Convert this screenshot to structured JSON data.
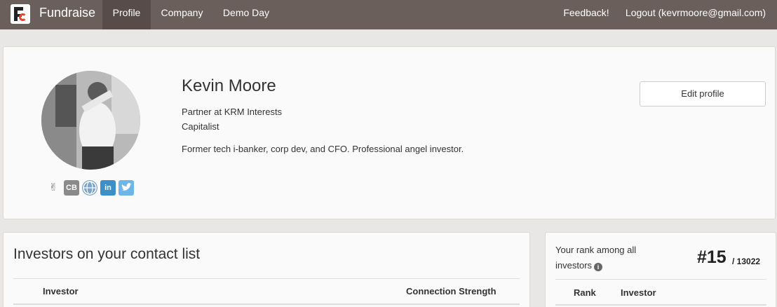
{
  "nav": {
    "brand": "Fundraise",
    "items": [
      {
        "label": "Profile",
        "active": true
      },
      {
        "label": "Company",
        "active": false
      },
      {
        "label": "Demo Day",
        "active": false
      }
    ],
    "feedback": "Feedback!",
    "logout": "Logout (kevrmoore@gmail.com)"
  },
  "profile": {
    "name": "Kevin Moore",
    "title_line1": "Partner at KRM Interests",
    "title_line2": "Capitalist",
    "bio": "Former tech i-banker, corp dev, and CFO. Professional angel investor.",
    "edit_button": "Edit profile",
    "social_icons": [
      "angellist-icon",
      "crunchbase-icon",
      "website-globe-icon",
      "linkedin-icon",
      "twitter-icon"
    ],
    "social_labels": {
      "crunchbase": "CB",
      "linkedin": "in"
    }
  },
  "investors": {
    "title": "Investors on your contact list",
    "columns": [
      "Investor",
      "Connection Strength"
    ]
  },
  "rank": {
    "label_line1": "Your rank among all",
    "label_line2": "investors",
    "rank_value": "#15",
    "rank_total": "/ 13022",
    "columns": [
      "Rank",
      "Investor"
    ]
  },
  "colors": {
    "nav_bg": "#6b5f5b",
    "nav_active": "#574c49",
    "page_bg": "#e9e7e5",
    "logo_accent": "#e8452c"
  }
}
